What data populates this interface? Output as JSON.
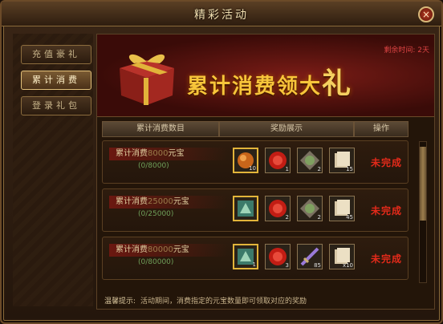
{
  "window": {
    "title": "精彩活动",
    "close_label": "×"
  },
  "tabs": [
    {
      "label": "充值豪礼",
      "active": false
    },
    {
      "label": "累计消费",
      "active": true
    },
    {
      "label": "登录礼包",
      "active": false
    }
  ],
  "banner": {
    "title_main": "累计消费领大",
    "title_big": "礼",
    "remaining": "剩余时间: 2天"
  },
  "table": {
    "headers": [
      "累计消费数目",
      "奖励展示",
      "操作"
    ],
    "rows": [
      {
        "label_prefix": "累计消费",
        "amount": "8000",
        "unit": "元宝",
        "progress": "(0/8000)",
        "items": [
          {
            "icon": "orb-icon",
            "count": "10",
            "gold": true
          },
          {
            "icon": "red-gem-icon",
            "count": "1",
            "gold": false
          },
          {
            "icon": "green-orb-icon",
            "count": "2",
            "gold": false
          },
          {
            "icon": "scroll-icon",
            "count": "15",
            "gold": false
          }
        ],
        "status": "未完成"
      },
      {
        "label_prefix": "累计消费",
        "amount": "25000",
        "unit": "元宝",
        "progress": "(0/25000)",
        "items": [
          {
            "icon": "dragon-icon",
            "count": "",
            "gold": true
          },
          {
            "icon": "red-gem-icon",
            "count": "2",
            "gold": false
          },
          {
            "icon": "green-orb-icon",
            "count": "2",
            "gold": false
          },
          {
            "icon": "scroll-icon",
            "count": "45",
            "gold": false
          }
        ],
        "status": "未完成"
      },
      {
        "label_prefix": "累计消费",
        "amount": "80000",
        "unit": "元宝",
        "progress": "(0/80000)",
        "items": [
          {
            "icon": "dragon-icon",
            "count": "1",
            "gold": true
          },
          {
            "icon": "red-gem-icon",
            "count": "3",
            "gold": false
          },
          {
            "icon": "sword-icon",
            "count": "85",
            "gold": false
          },
          {
            "icon": "scroll-icon",
            "count": "x10",
            "gold": false
          }
        ],
        "status": "未完成"
      }
    ]
  },
  "tip": {
    "label": "温馨提示:",
    "text": "活动期间，消费指定的元宝数量即可领取对应的奖励"
  },
  "colors": {
    "status": "#e42a1a",
    "banner_text": "#f7c53a"
  }
}
